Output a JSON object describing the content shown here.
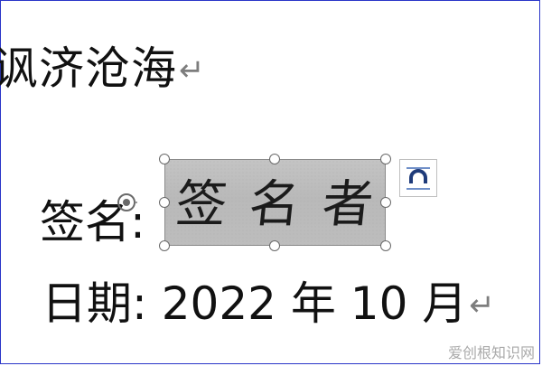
{
  "document": {
    "line1": "讽济沧海",
    "line2_label": "签名:",
    "line3": "日期: 2022 年 10 月",
    "pilcrow": "↵"
  },
  "signature_image": {
    "text": [
      "签",
      "名",
      "者"
    ]
  },
  "layout_options_button": {
    "icon": "wrap-text-icon"
  },
  "watermark": "爱创根知识网",
  "colors": {
    "frame": "#2a35c8",
    "image_bg": "#bdbdbd",
    "handle_border": "#6a6a6a"
  }
}
